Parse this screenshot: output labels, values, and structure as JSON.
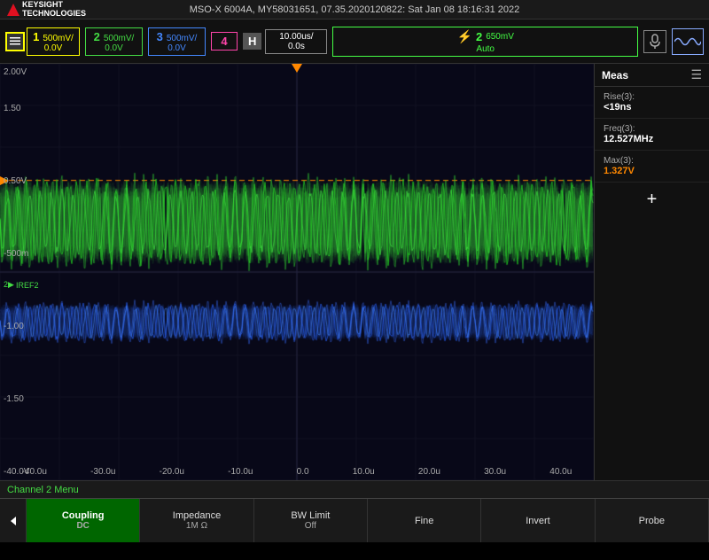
{
  "header": {
    "title": "MSO-X 6004A,  MY58031651,  07.35.2020120822: Sat Jan 08 18:16:31 2022"
  },
  "logo": {
    "brand": "KEYSIGHT",
    "sub": "TECHNOLOGIES"
  },
  "channels": [
    {
      "num": "1",
      "scale": "500mV/",
      "offset": "0.0V",
      "active": false
    },
    {
      "num": "2",
      "scale": "500mV/",
      "offset": "0.0V",
      "active": true
    },
    {
      "num": "3",
      "scale": "500mV/",
      "offset": "0.0V",
      "active": false
    },
    {
      "num": "4",
      "scale": "",
      "offset": "",
      "active": false
    }
  ],
  "horizontal": {
    "label": "H",
    "scale": "10.00us/",
    "offset": "0.0s"
  },
  "trigger": {
    "icon": "⚡",
    "num": "2",
    "level": "650mV",
    "mode": "Auto"
  },
  "measurements": {
    "title": "Meas",
    "items": [
      {
        "name": "Rise(3):",
        "value": "<19ns",
        "color": "white"
      },
      {
        "name": "Freq(3):",
        "value": "12.527MHz",
        "color": "white"
      },
      {
        "name": "Max(3):",
        "value": "1.327V",
        "color": "orange"
      }
    ],
    "add_label": "+"
  },
  "y_labels": [
    "2.00V",
    "1.50",
    "",
    "0.50V",
    "",
    "-500m",
    "",
    "-1.00",
    "",
    "-1.50",
    "",
    "-40.0V"
  ],
  "x_labels": [
    "-40.0u",
    "-30.0u",
    "-20.0u",
    "-10.0u",
    "0.0",
    "10.0u",
    "20.0u",
    "30.0u",
    "40.0u"
  ],
  "channel2_menu": {
    "label": "Channel 2 Menu"
  },
  "bottom_buttons": [
    {
      "label": "Coupling",
      "value": "DC",
      "active": true,
      "color": "green"
    },
    {
      "label": "Impedance",
      "value": "1M Ω",
      "active": false,
      "color": "normal"
    },
    {
      "label": "BW Limit",
      "value": "Off",
      "active": false,
      "color": "normal"
    },
    {
      "label": "Fine",
      "value": "",
      "active": false,
      "color": "normal"
    },
    {
      "label": "Invert",
      "value": "",
      "active": false,
      "color": "normal"
    },
    {
      "label": "Probe",
      "value": "",
      "active": false,
      "color": "normal"
    }
  ],
  "waveform": {
    "green_color": "#44dd44",
    "blue_color": "#4477ff",
    "orange_line_pct": 28,
    "trigger_arrow_left_pct": 50
  }
}
